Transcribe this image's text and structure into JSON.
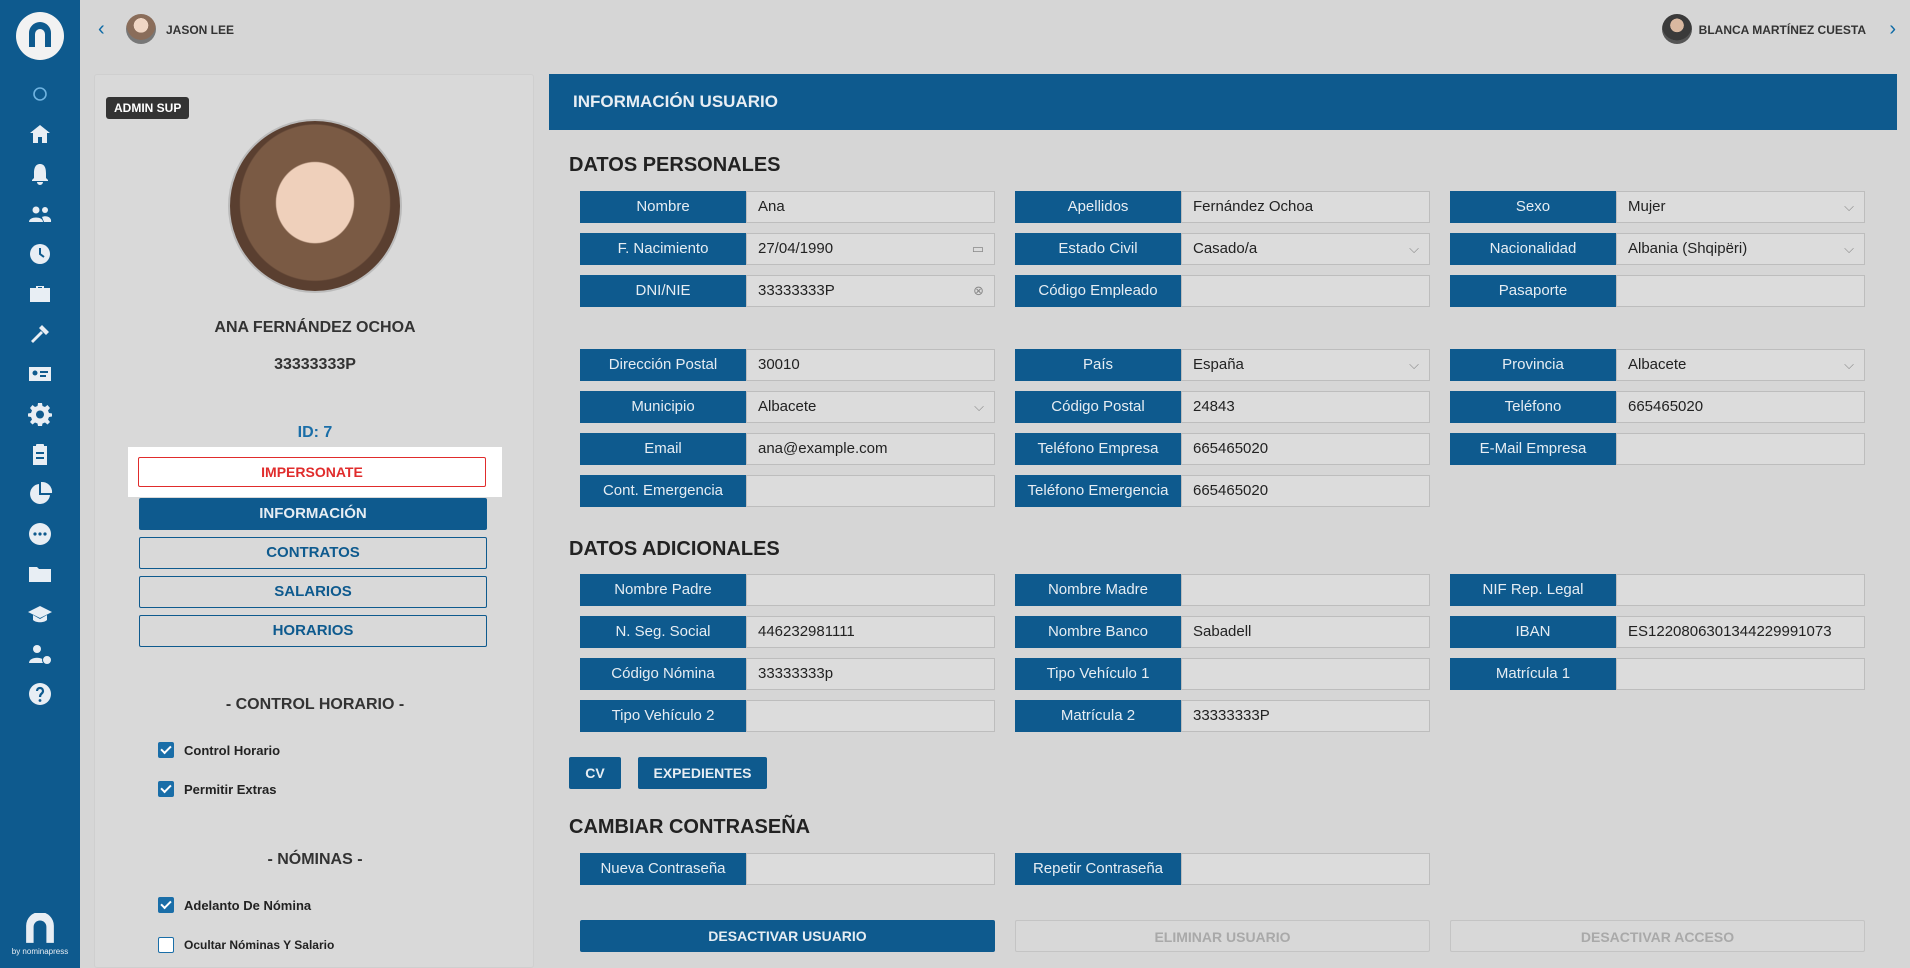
{
  "sidebar": {
    "items": [
      "circle-icon",
      "home-icon",
      "bell-icon",
      "users-icon",
      "clock-icon",
      "briefcase-icon",
      "tools-icon",
      "id-card-icon",
      "gear-icon",
      "clipboard-icon",
      "pie-chart-icon",
      "chat-icon",
      "folder-icon",
      "graduation-icon",
      "user-payment-icon",
      "help-icon"
    ],
    "footer": "by nominapress"
  },
  "topbar": {
    "left_user": "JASON LEE",
    "right_user": "BLANCA MARTÍNEZ CUESTA"
  },
  "profile": {
    "badge": "ADMIN SUP",
    "name": "ANA FERNÁNDEZ OCHOA",
    "dni": "33333333P",
    "id_label": "ID: 7",
    "impersonate": "IMPERSONATE",
    "buttons": [
      "INFORMACIÓN",
      "CONTRATOS",
      "SALARIOS",
      "HORARIOS"
    ],
    "control_title": "- CONTROL HORARIO -",
    "control_items": [
      {
        "label": "Control Horario",
        "checked": true
      },
      {
        "label": "Permitir Extras",
        "checked": true
      }
    ],
    "nominas_title": "- NÓMINAS -",
    "nominas_items": [
      {
        "label": "Adelanto De Nómina",
        "checked": true
      },
      {
        "label": "Ocultar Nóminas Y Salario",
        "checked": false
      }
    ]
  },
  "main": {
    "header": "INFORMACIÓN USUARIO",
    "sections": {
      "personal": "DATOS PERSONALES",
      "additional": "DATOS ADICIONALES",
      "password": "CAMBIAR CONTRASEÑA"
    },
    "personal": [
      {
        "label": "Nombre",
        "value": "Ana"
      },
      {
        "label": "Apellidos",
        "value": "Fernández Ochoa"
      },
      {
        "label": "Sexo",
        "value": "Mujer",
        "suffix": "chevron"
      },
      {
        "label": "F. Nacimiento",
        "value": "27/04/1990",
        "suffix": "calendar"
      },
      {
        "label": "Estado Civil",
        "value": "Casado/a",
        "suffix": "chevron"
      },
      {
        "label": "Nacionalidad",
        "value": "Albania (Shqipëri)",
        "suffix": "chevron"
      },
      {
        "label": "DNI/NIE",
        "value": "33333333P",
        "suffix": "clear"
      },
      {
        "label": "Código Empleado",
        "value": ""
      },
      {
        "label": "Pasaporte",
        "value": ""
      }
    ],
    "address": [
      {
        "label": "Dirección Postal",
        "value": "30010"
      },
      {
        "label": "País",
        "value": "España",
        "suffix": "chevron"
      },
      {
        "label": "Provincia",
        "value": "Albacete",
        "suffix": "chevron"
      },
      {
        "label": "Municipio",
        "value": "Albacete",
        "suffix": "chevron"
      },
      {
        "label": "Código Postal",
        "value": "24843"
      },
      {
        "label": "Teléfono",
        "value": "665465020"
      },
      {
        "label": "Email",
        "value": "ana@example.com"
      },
      {
        "label": "Teléfono Empresa",
        "value": "665465020"
      },
      {
        "label": "E-Mail Empresa",
        "value": ""
      },
      {
        "label": "Cont. Emergencia",
        "value": ""
      },
      {
        "label": "Teléfono Emergencia",
        "value": "665465020"
      }
    ],
    "additional": [
      {
        "label": "Nombre Padre",
        "value": ""
      },
      {
        "label": "Nombre Madre",
        "value": ""
      },
      {
        "label": "NIF Rep. Legal",
        "value": ""
      },
      {
        "label": "N. Seg. Social",
        "value": "446232981111"
      },
      {
        "label": "Nombre Banco",
        "value": "Sabadell"
      },
      {
        "label": "IBAN",
        "value": "ES1220806301344229991073"
      },
      {
        "label": "Código Nómina",
        "value": "33333333p"
      },
      {
        "label": "Tipo Vehículo 1",
        "value": ""
      },
      {
        "label": "Matrícula 1",
        "value": ""
      },
      {
        "label": "Tipo Vehículo 2",
        "value": ""
      },
      {
        "label": "Matrícula 2",
        "value": "33333333P"
      }
    ],
    "doc_buttons": [
      "CV",
      "EXPEDIENTES"
    ],
    "password": [
      {
        "label": "Nueva Contraseña",
        "value": ""
      },
      {
        "label": "Repetir Contraseña",
        "value": ""
      }
    ],
    "actions": [
      "DESACTIVAR USUARIO",
      "ELIMINAR USUARIO",
      "DESACTIVAR ACCESO"
    ]
  }
}
